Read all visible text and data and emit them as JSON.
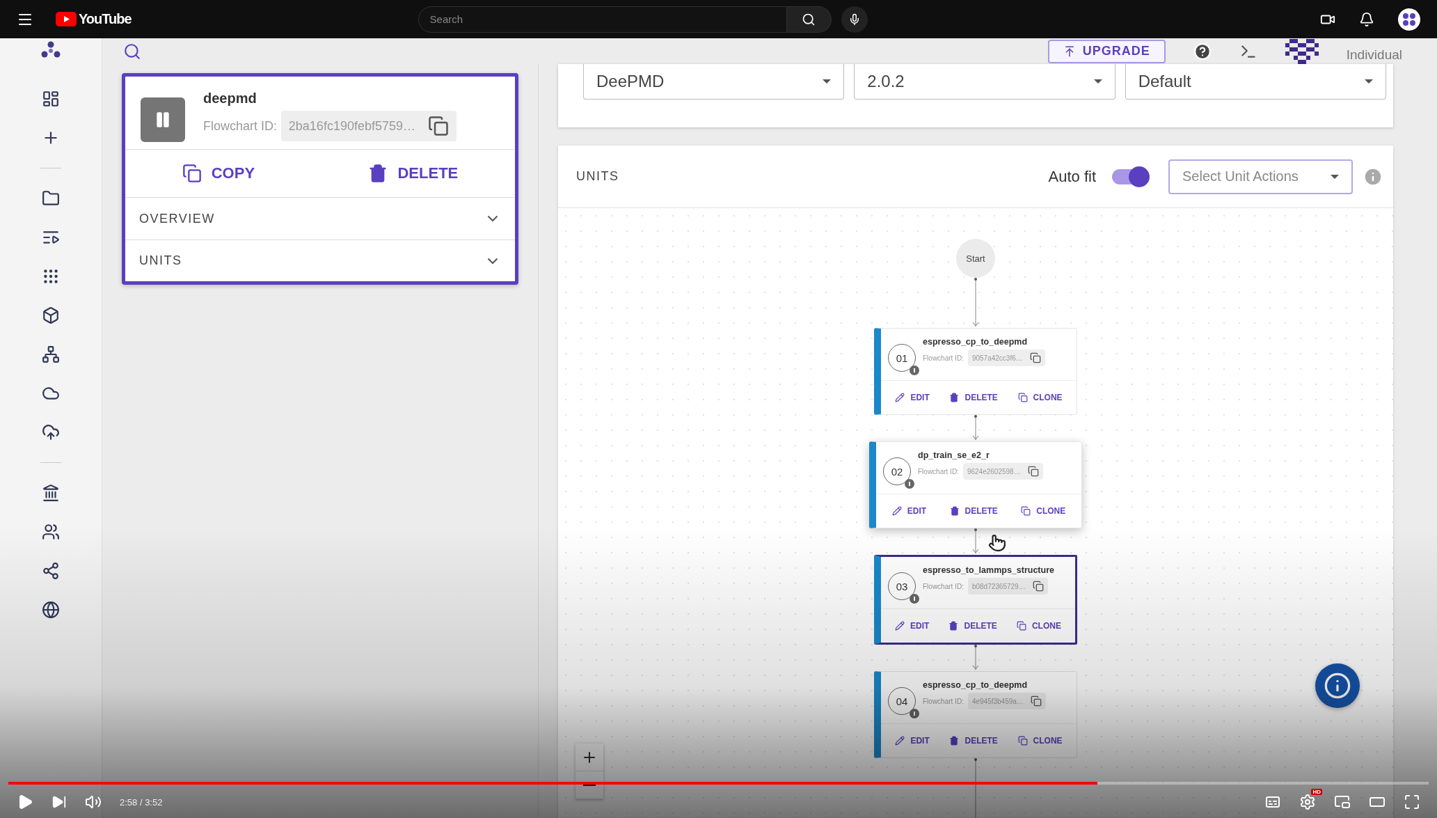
{
  "player": {
    "logo": "YouTube",
    "search": {
      "placeholder": "Search"
    },
    "progress": {
      "level": 0.767
    },
    "time": "2:58 / 3:52",
    "quality_badge": "HD"
  },
  "app": {
    "header": {
      "upgrade": "UPGRADE",
      "account": "Individual"
    },
    "workflow": {
      "name": "deepmd",
      "id_label": "Flowchart ID:",
      "id": "2ba16fc190febf5759…",
      "actions": [
        "COPY",
        "DELETE"
      ],
      "sections": [
        {
          "label": "OVERVIEW",
          "expanded": false
        },
        {
          "label": "UNITS",
          "expanded": false
        }
      ]
    },
    "selects": [
      "DeePMD",
      "2.0.2",
      "Default"
    ],
    "units_panel": {
      "title": "UNITS",
      "auto_fit": {
        "label": "Auto fit",
        "on": true
      },
      "actions_select": {
        "placeholder": "Select Unit Actions"
      },
      "start": "Start",
      "units": [
        {
          "index": "01",
          "name": "espresso_cp_to_deepmd",
          "id_label": "Flowchart ID:",
          "id": "9057a42cc3f6…",
          "actions": [
            "EDIT",
            "DELETE",
            "CLONE"
          ],
          "selected": false,
          "hovered": false
        },
        {
          "index": "02",
          "name": "dp_train_se_e2_r",
          "id_label": "Flowchart ID:",
          "id": "9624e2602598…",
          "actions": [
            "EDIT",
            "DELETE",
            "CLONE"
          ],
          "selected": false,
          "hovered": true
        },
        {
          "index": "03",
          "name": "espresso_to_lammps_structure",
          "id_label": "Flowchart ID:",
          "id": "b08d72365729…",
          "actions": [
            "EDIT",
            "DELETE",
            "CLONE"
          ],
          "selected": true,
          "hovered": false
        },
        {
          "index": "04",
          "name": "espresso_cp_to_deepmd",
          "id_label": "Flowchart ID:",
          "id": "4e945f3b459a…",
          "actions": [
            "EDIT",
            "DELETE",
            "CLONE"
          ],
          "selected": false,
          "hovered": false
        }
      ]
    }
  }
}
